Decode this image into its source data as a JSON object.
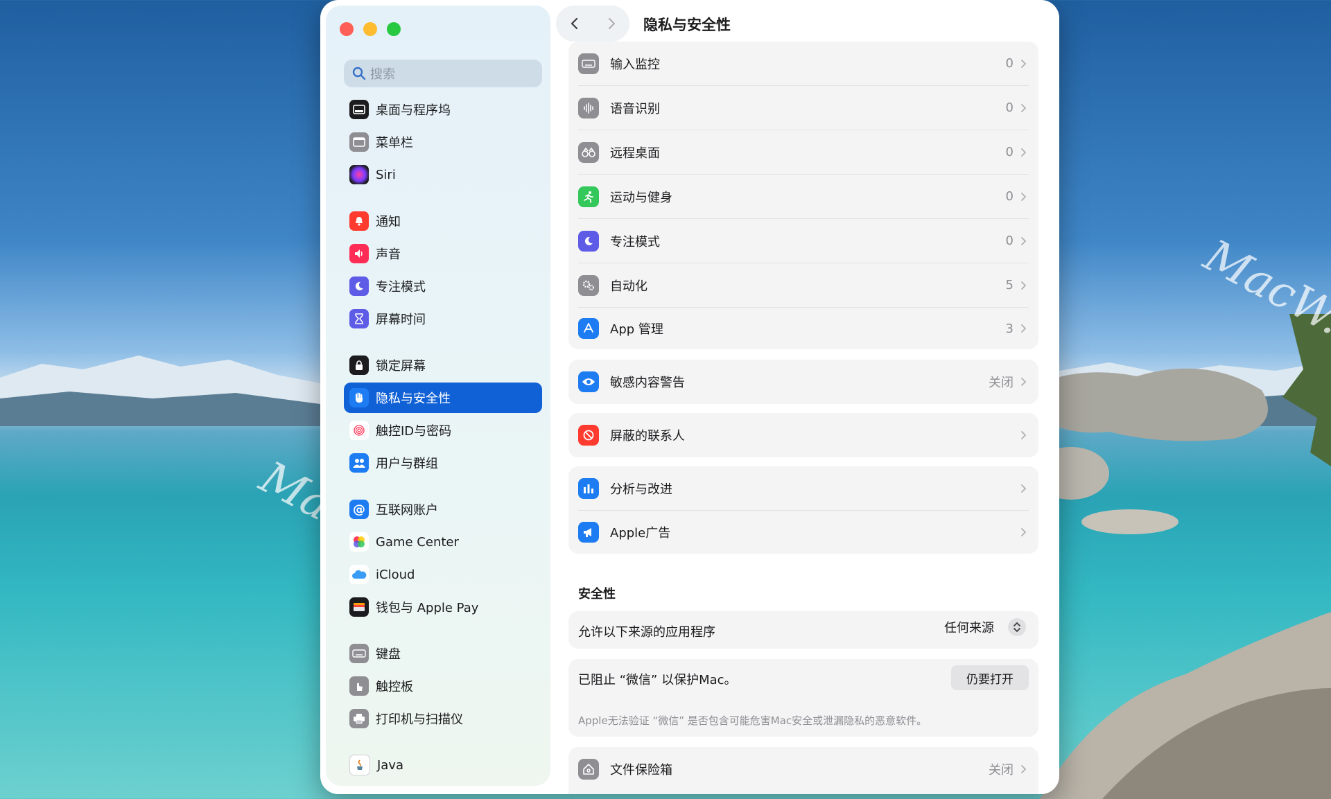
{
  "watermark": "MacW.com",
  "sidebar": {
    "search_placeholder": "搜索",
    "items": [
      {
        "label": "桌面与程序坞",
        "icon": "dock-icon"
      },
      {
        "label": "菜单栏",
        "icon": "menubar-icon"
      },
      {
        "label": "Siri",
        "icon": "siri-icon"
      },
      {
        "label": "通知",
        "icon": "bell-icon"
      },
      {
        "label": "声音",
        "icon": "speaker-icon"
      },
      {
        "label": "专注模式",
        "icon": "moon-icon"
      },
      {
        "label": "屏幕时间",
        "icon": "hourglass-icon"
      },
      {
        "label": "锁定屏幕",
        "icon": "lock-icon"
      },
      {
        "label": "隐私与安全性",
        "icon": "hand-icon",
        "selected": true
      },
      {
        "label": "触控ID与密码",
        "icon": "fingerprint-icon"
      },
      {
        "label": "用户与群组",
        "icon": "users-icon"
      },
      {
        "label": "互联网账户",
        "icon": "at-icon"
      },
      {
        "label": "Game Center",
        "icon": "game-center-icon"
      },
      {
        "label": "iCloud",
        "icon": "cloud-icon"
      },
      {
        "label": "钱包与 Apple Pay",
        "icon": "wallet-icon"
      },
      {
        "label": "键盘",
        "icon": "keyboard-icon"
      },
      {
        "label": "触控板",
        "icon": "trackpad-icon"
      },
      {
        "label": "打印机与扫描仪",
        "icon": "printer-icon"
      },
      {
        "label": "Java",
        "icon": "java-icon"
      }
    ]
  },
  "header": {
    "title": "隐私与安全性"
  },
  "privacy": {
    "rows": [
      {
        "label": "输入监控",
        "value": "0",
        "icon": "keyboard-icon"
      },
      {
        "label": "语音识别",
        "value": "0",
        "icon": "waveform-icon"
      },
      {
        "label": "远程桌面",
        "value": "0",
        "icon": "binoculars-icon"
      },
      {
        "label": "运动与健身",
        "value": "0",
        "icon": "running-icon"
      },
      {
        "label": "专注模式",
        "value": "0",
        "icon": "moon-icon"
      },
      {
        "label": "自动化",
        "value": "5",
        "icon": "gears-icon"
      },
      {
        "label": "App 管理",
        "value": "3",
        "icon": "app-store-icon"
      }
    ],
    "sensitive": {
      "label": "敏感内容警告",
      "value": "关闭"
    },
    "blocked": {
      "label": "屏蔽的联系人"
    },
    "analytics": {
      "label": "分析与改进"
    },
    "ads": {
      "label": "Apple广告"
    }
  },
  "security": {
    "title": "安全性",
    "allow_label": "允许以下来源的应用程序",
    "allow_value": "任何来源",
    "blocked_app": "已阻止 “微信” 以保护Mac。",
    "open_anyway": "仍要打开",
    "note": "Apple无法验证 “微信” 是否包含可能危害Mac安全或泄漏隐私的恶意软件。",
    "filevault": {
      "label": "文件保险箱",
      "value": "关闭"
    }
  },
  "colors": {
    "accent": "#1060d6",
    "close": "#ff5f57",
    "minimize": "#febc2e",
    "zoom": "#28c840"
  }
}
